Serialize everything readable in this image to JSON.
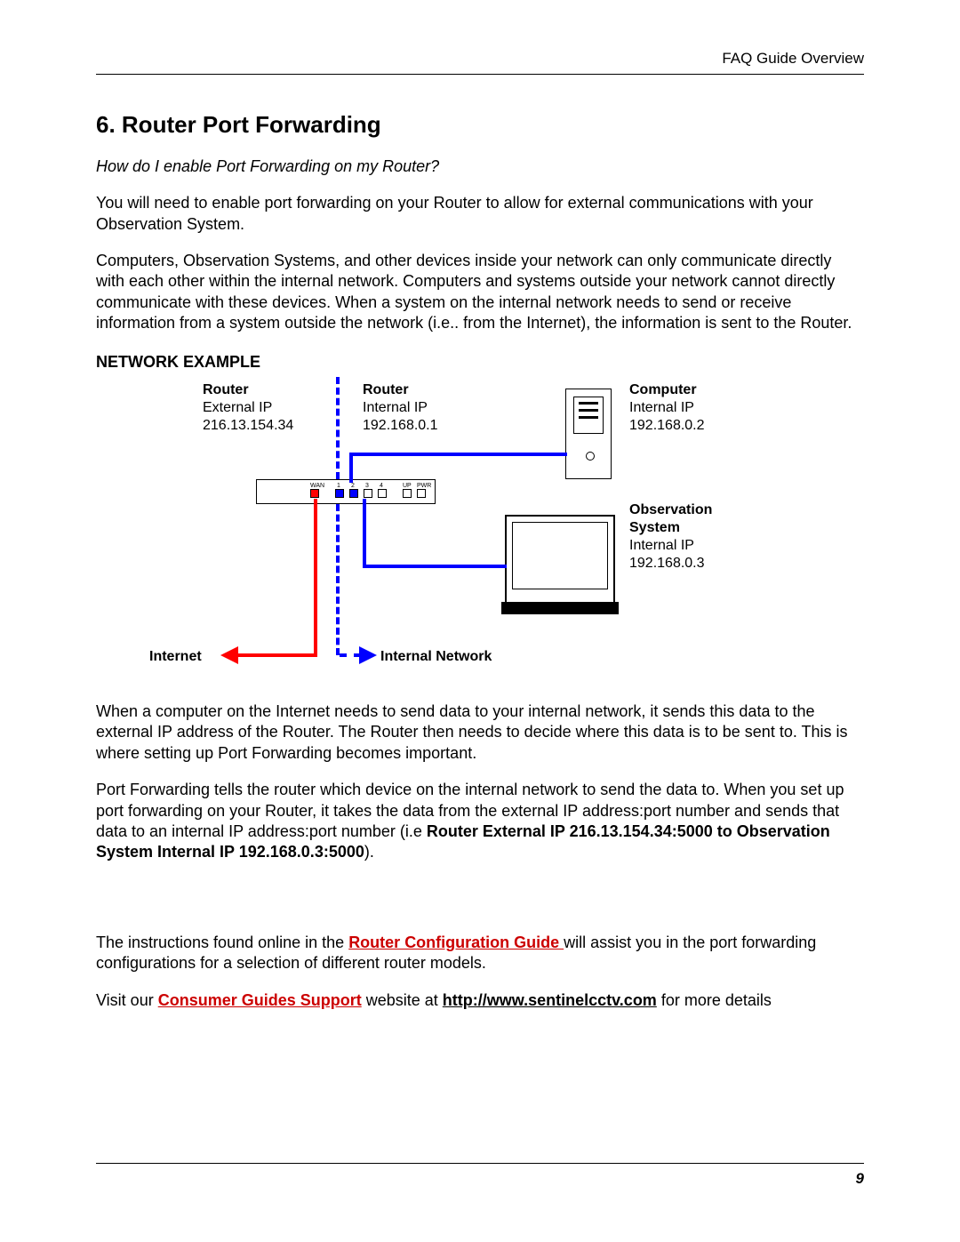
{
  "header": {
    "running": "FAQ Guide Overview"
  },
  "title": "6. Router Port Forwarding",
  "subtitle": "How do I enable Port Forwarding on my Router?",
  "para1": "You will need to enable port forwarding on your Router to allow for external communications with your Observation System.",
  "para2": "Computers, Observation Systems, and other devices inside your network can only communicate directly with each other within the internal network. Computers and systems outside your network cannot directly communicate with these devices. When a system on the internal network needs to send or receive information from a system outside the network (i.e.. from the Internet), the information is sent to the Router.",
  "network_heading": "NETWORK EXAMPLE",
  "diagram": {
    "router_ext": {
      "title": "Router",
      "l1": "External IP",
      "l2": "216.13.154.34"
    },
    "router_int": {
      "title": "Router",
      "l1": "Internal IP",
      "l2": "192.168.0.1"
    },
    "computer": {
      "title": "Computer",
      "l1": "Internal IP",
      "l2": "192.168.0.2"
    },
    "obs": {
      "title": "Observation",
      "title2": "System",
      "l1": "Internal IP",
      "l2": "192.168.0.3"
    },
    "internet": "Internet",
    "internal_net": "Internal Network",
    "router_ports": {
      "wan": "WAN",
      "p1": "1",
      "p2": "2",
      "p3": "3",
      "p4": "4",
      "up": "UP",
      "pwr": "PWR"
    }
  },
  "para3": "When a computer on the Internet needs to send data to your internal network, it sends this data to the external IP address of the Router. The Router then needs to decide where this data is to be sent to. This is where setting up Port Forwarding becomes important.",
  "para4_lead": "Port Forwarding tells the router which device on the internal network to send the data to. When you set up port forwarding on your Router, it takes the data from the external IP address:port number and sends that data to an internal IP address:port number (i.e ",
  "para4_bold": "Router External IP 216.13.154.34:5000 to Observation System Internal IP 192.168.0.3:5000",
  "para4_tail": ").",
  "instr_lead": "The instructions found online in the ",
  "instr_link": "Router Configuration Guide ",
  "instr_tail": "will assist you in the port forwarding configurations for a selection of different router models.",
  "visit_lead": "Visit our ",
  "visit_link1": "Consumer Guides Support",
  "visit_mid": " website at ",
  "visit_url": "http://www.sentinelcctv.com",
  "visit_tail": " for more details",
  "page_number": "9"
}
